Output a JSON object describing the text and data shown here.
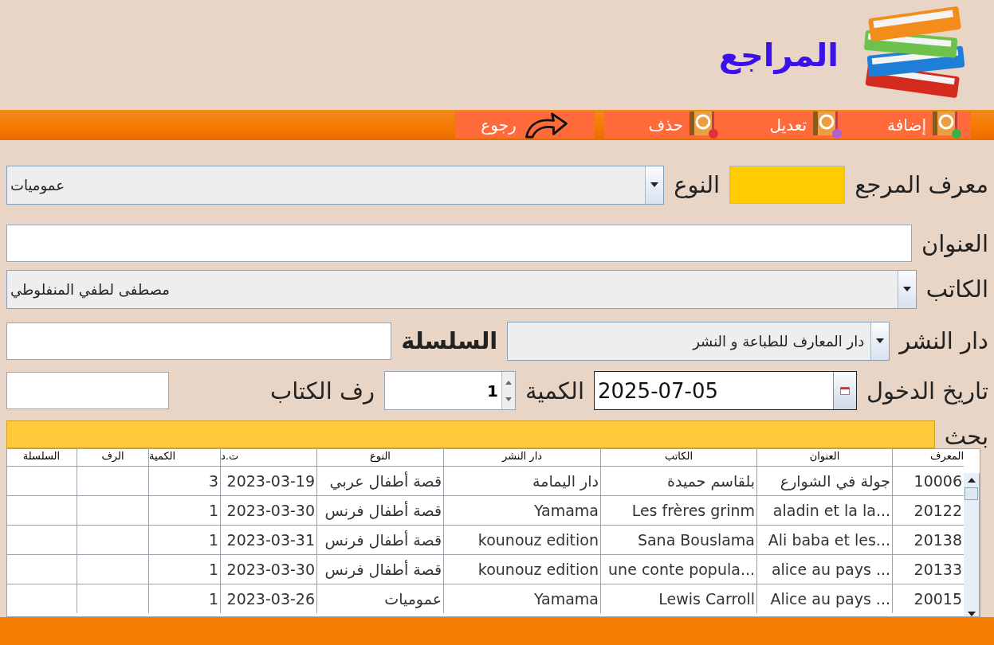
{
  "header": {
    "title": "المراجع"
  },
  "toolbar": [
    {
      "kind": "add",
      "label": "إضافة"
    },
    {
      "kind": "edit",
      "label": "تعديل"
    },
    {
      "kind": "delete",
      "label": "حذف"
    },
    {
      "kind": "back",
      "label": "رجوع"
    }
  ],
  "form": {
    "reference_id": {
      "label": "معرف المرجع"
    },
    "type": {
      "label": "النوع",
      "value": "عموميات"
    },
    "title": {
      "label": "العنوان"
    },
    "author": {
      "label": "الكاتب",
      "value": "مصطفى لطفي المنفلوطي"
    },
    "publisher": {
      "label": "دار النشر",
      "value": "دار المعارف للطباعة و النشر"
    },
    "series": {
      "label": "السلسلة"
    },
    "entry_date": {
      "label": "تاريخ الدخول",
      "value": "2025-07-05"
    },
    "quantity": {
      "label": "الكمية",
      "value": "1"
    },
    "shelf": {
      "label": "رف الكتاب"
    },
    "search": {
      "label": "بحث"
    }
  },
  "table": {
    "columns": [
      "المعرف",
      "العنوان",
      "الكاتب",
      "دار النشر",
      "النوع",
      "ت.د",
      "الكمية",
      "الرف",
      "السلسلة"
    ],
    "rows": [
      [
        "10006",
        "جولة في الشوارع",
        "بلقاسم حميدة",
        "دار اليمامة",
        "قصة أطفال عربي",
        "2023-03-19",
        "3"
      ],
      [
        "20122",
        "aladin et la la...",
        "Les frères grinm",
        "Yamama",
        "قصة أطفال فرنس",
        "2023-03-30",
        "1"
      ],
      [
        "20138",
        "Ali baba et les...",
        "Sana Bouslama",
        "kounouz edition",
        "قصة أطفال فرنس",
        "2023-03-31",
        "1"
      ],
      [
        "20133",
        "alice au pays ...",
        "une conte popula...",
        "kounouz edition",
        "قصة أطفال فرنس",
        "2023-03-30",
        "1"
      ],
      [
        "20015",
        "Alice au pays ...",
        "Lewis Carroll",
        "Yamama",
        "عموميات",
        "2023-03-26",
        "1"
      ]
    ]
  }
}
